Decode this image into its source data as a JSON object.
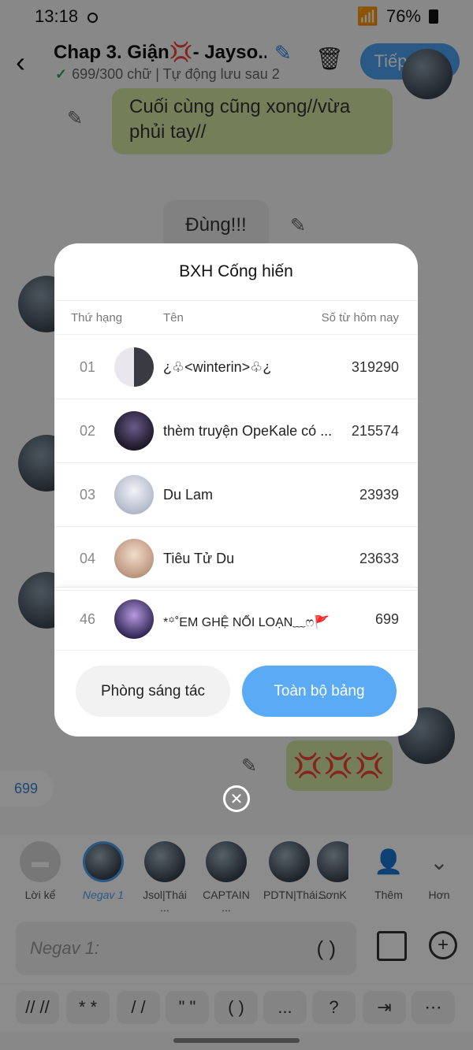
{
  "status": {
    "time": "13:18",
    "battery": "76%"
  },
  "header": {
    "title": "Chap 3. Giận💢- Jayso...",
    "subtitle": "699/300 chữ | Tự động lưu sau 2",
    "next_label": "Tiếp theo"
  },
  "chat": {
    "bubble1": "Cuối cùng cũng xong//vừa phủi tay//",
    "bubble2": "Đùng!!!",
    "emoji_bubble": "💢💢💢",
    "count": "699"
  },
  "characters": [
    {
      "label": "Lời kể"
    },
    {
      "label": "Negav 1"
    },
    {
      "label": "Jsol|Thái ..."
    },
    {
      "label": "CAPTAIN ..."
    },
    {
      "label": "PDTN|Thái..."
    },
    {
      "label": "SơnK"
    },
    {
      "label": "Thêm"
    },
    {
      "label": "Hơn"
    }
  ],
  "input": {
    "placeholder": "Negav 1:",
    "paren": "( )"
  },
  "quick_keys": [
    "// //",
    "* *",
    "/ /",
    "\" \"",
    "( )",
    "...",
    "?"
  ],
  "leaderboard": {
    "title": "BXH Cống hiến",
    "col_rank": "Thứ hạng",
    "col_name": "Tên",
    "col_words": "Số từ hôm nay",
    "rows": [
      {
        "rank": "01",
        "name": "¿♧<winterin>♧¿",
        "value": "319290"
      },
      {
        "rank": "02",
        "name": "thèm truyện OpeKale có ...",
        "value": "215574"
      },
      {
        "rank": "03",
        "name": "Du Lam",
        "value": "23939"
      },
      {
        "rank": "04",
        "name": "Tiêu Tử Du",
        "value": "23633"
      }
    ],
    "me": {
      "rank": "46",
      "name": "*꙳˚EM GHỆ NỔI LOẠN﹏ෆ🚩",
      "value": "699"
    },
    "btn_studio": "Phòng sáng tác",
    "btn_full": "Toàn bộ bảng"
  }
}
